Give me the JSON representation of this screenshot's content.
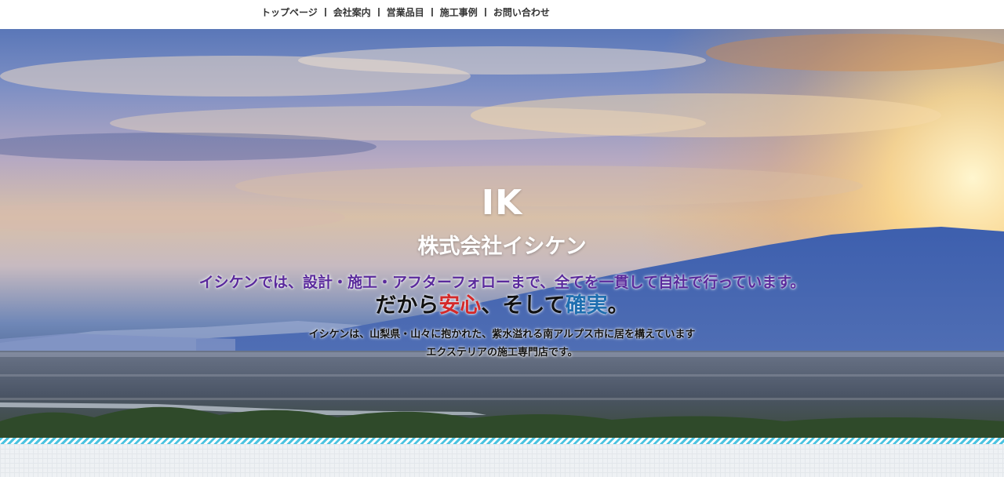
{
  "nav": {
    "items": [
      {
        "label": "トップページ"
      },
      {
        "label": "会社案内"
      },
      {
        "label": "営業品目"
      },
      {
        "label": "施工事例"
      },
      {
        "label": "お問い合わせ"
      }
    ]
  },
  "hero": {
    "logo": "IK",
    "company_name": "株式会社イシケン",
    "tagline_line1": "イシケンでは、設計・施工・アフターフォローまで、全てを一貫して自社で行っています。",
    "tagline_line2": {
      "part1": "だから",
      "part2": "安心",
      "part3": "、そして",
      "part4": "確実",
      "part5": "。"
    },
    "description_line1": "イシケンは、山梨県・山々に抱かれた、紫水溢れる南アルプス市に居を構えています",
    "description_line2": "エクステリアの施工専門店です。"
  },
  "colors": {
    "tagline_purple": "#5a2a9c",
    "accent_red": "#d42a2a",
    "accent_blue": "#1f6fb0",
    "stripe": "#4cc3e0"
  }
}
